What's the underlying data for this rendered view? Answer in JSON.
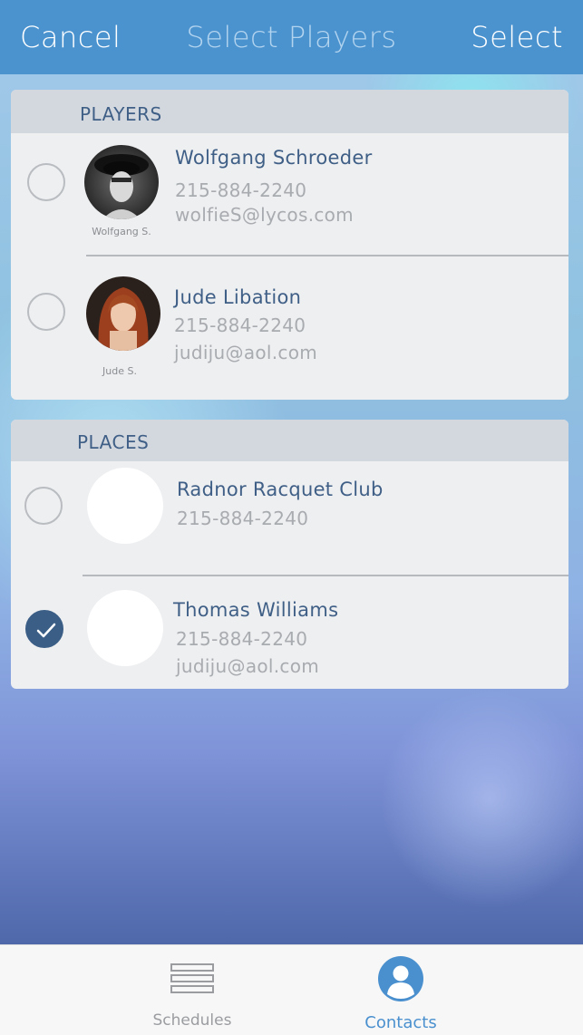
{
  "navbar": {
    "cancel_label": "Cancel",
    "title": "Select Players",
    "select_label": "Select",
    "color": "#4b93cf"
  },
  "players_section": {
    "header": "PLAYERS",
    "items": [
      {
        "name": "Wolfgang Schroeder",
        "phone": "215-884-2240",
        "email": "wolfieS@lycos.com",
        "avatar_caption": "Wolfgang S.",
        "selected": false,
        "avatar_icon": "photo-portrait-man"
      },
      {
        "name": "Jude Libation",
        "phone": "215-884-2240",
        "email": "judiju@aol.com",
        "avatar_caption": "Jude S.",
        "selected": false,
        "avatar_icon": "photo-portrait-woman"
      }
    ]
  },
  "places_section": {
    "header": "PLACES",
    "items": [
      {
        "name": "Radnor Racquet Club",
        "phone": "215-884-2240",
        "selected": false,
        "avatar_icon": "blank-avatar"
      },
      {
        "name": "Thomas Williams",
        "phone": "215-884-2240",
        "email": "judiju@aol.com",
        "selected": true,
        "avatar_icon": "blank-avatar"
      }
    ]
  },
  "tabbar": {
    "tabs": [
      {
        "label": "Schedules",
        "icon": "list-icon",
        "active": false
      },
      {
        "label": "Contacts",
        "icon": "person-icon",
        "active": true
      }
    ],
    "active_color": "#4a90cf"
  },
  "colors": {
    "accent": "#3f5f86",
    "checked": "#3b5e86"
  }
}
